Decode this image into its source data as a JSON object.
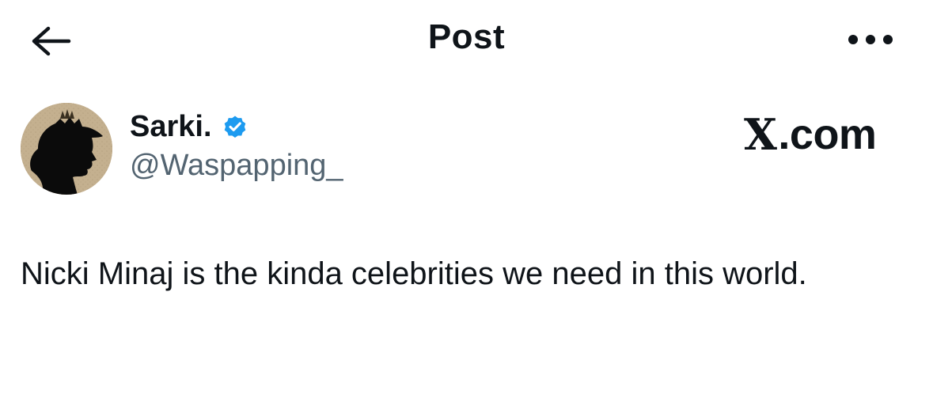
{
  "header": {
    "title": "Post",
    "back_icon": "arrow-left-icon",
    "more_icon": "more-horizontal-icon"
  },
  "author": {
    "display_name": "Sarki.",
    "handle": "@Waspapping_",
    "verified_icon": "verified-badge-icon",
    "verified_color": "#1d9bf0"
  },
  "watermark": {
    "x_letter": "X",
    "suffix": ".com"
  },
  "post": {
    "text": "Nicki Minaj is the kinda celebrities we need in this world."
  }
}
